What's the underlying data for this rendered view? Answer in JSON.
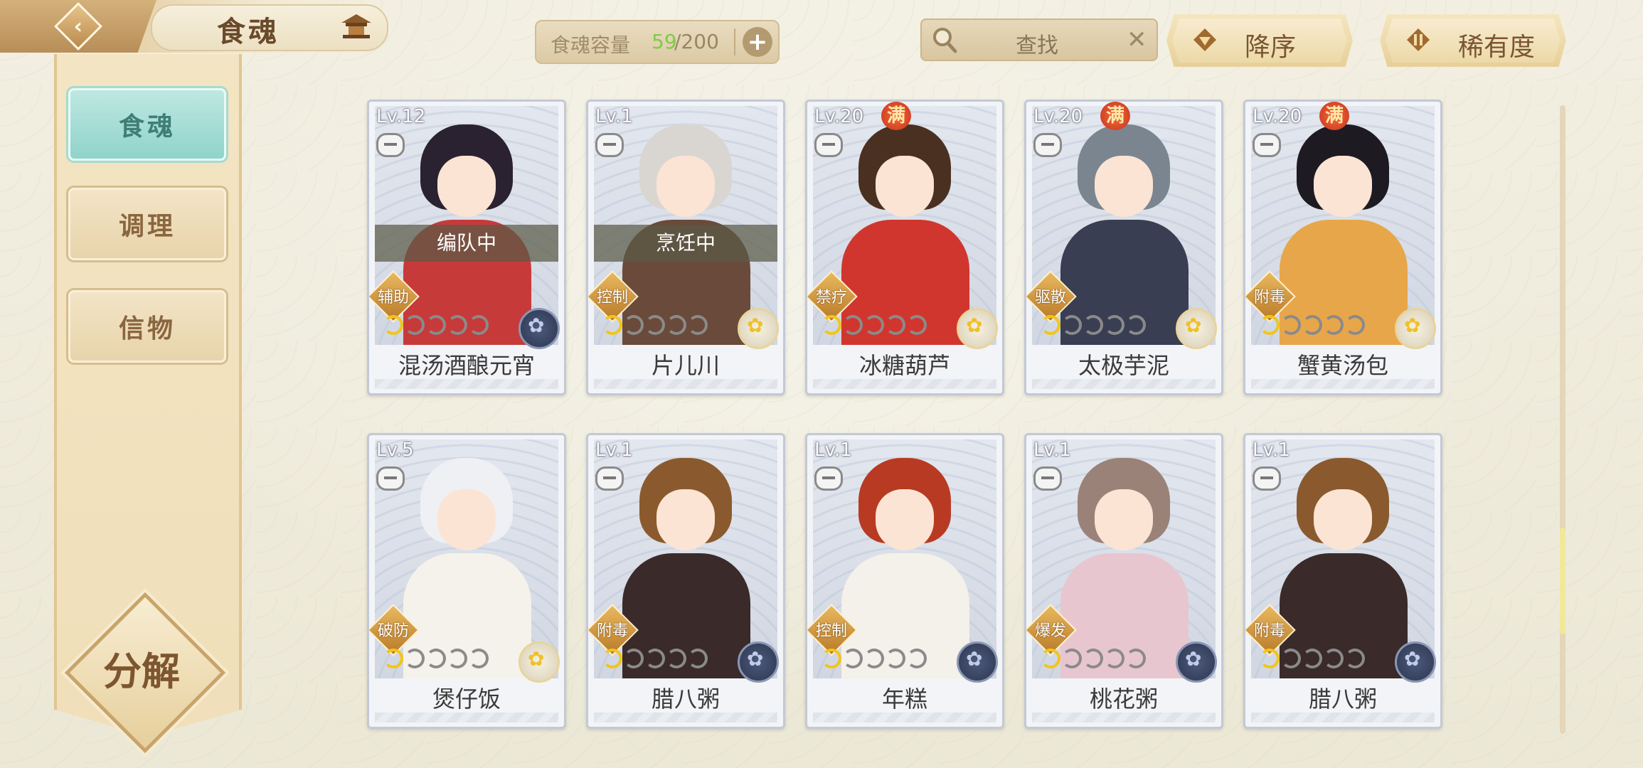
{
  "header": {
    "title": "食魂",
    "capacity_label": "食魂容量",
    "capacity_used": "59",
    "capacity_max": "/200",
    "add_label": "+",
    "search_placeholder": "查找",
    "sort_order_label": "降序",
    "sort_key_label": "稀有度"
  },
  "sidebar": {
    "tabs": [
      {
        "label": "食魂",
        "active": true
      },
      {
        "label": "调理",
        "active": false
      },
      {
        "label": "信物",
        "active": false
      }
    ],
    "decompose_label": "分解"
  },
  "cards": [
    {
      "level": "Lv.12",
      "full": "",
      "status": "编队中",
      "role": "辅助",
      "stars": 1,
      "quality": "dark",
      "name": "混汤酒酿元宵",
      "hair": "#2a2230",
      "body": "#c73a3a"
    },
    {
      "level": "Lv.1",
      "full": "",
      "status": "烹饪中",
      "role": "控制",
      "stars": 1,
      "quality": "gold",
      "name": "片儿川",
      "hair": "#d9d6d2",
      "body": "#6a4a3a"
    },
    {
      "level": "Lv.20",
      "full": "满",
      "status": "",
      "role": "禁疗",
      "stars": 1,
      "quality": "gold",
      "name": "冰糖葫芦",
      "hair": "#4a3020",
      "body": "#d0362e"
    },
    {
      "level": "Lv.20",
      "full": "满",
      "status": "",
      "role": "驱散",
      "stars": 1,
      "quality": "gold",
      "name": "太极芋泥",
      "hair": "#7a8590",
      "body": "#3a3e52"
    },
    {
      "level": "Lv.20",
      "full": "满",
      "status": "",
      "role": "附毒",
      "stars": 1,
      "quality": "gold",
      "name": "蟹黄汤包",
      "hair": "#1e1a22",
      "body": "#e8a64a"
    },
    {
      "level": "Lv.5",
      "full": "",
      "status": "",
      "role": "破防",
      "stars": 1,
      "quality": "gold",
      "name": "煲仔饭",
      "hair": "#eef0f4",
      "body": "#f4f2ea"
    },
    {
      "level": "Lv.1",
      "full": "",
      "status": "",
      "role": "附毒",
      "stars": 1,
      "quality": "dark",
      "name": "腊八粥",
      "hair": "#8a5a2e",
      "body": "#3a2a2a"
    },
    {
      "level": "Lv.1",
      "full": "",
      "status": "",
      "role": "控制",
      "stars": 1,
      "quality": "dark",
      "name": "年糕",
      "hair": "#b83a22",
      "body": "#f4f0ea"
    },
    {
      "level": "Lv.1",
      "full": "",
      "status": "",
      "role": "爆发",
      "stars": 1,
      "quality": "dark",
      "name": "桃花粥",
      "hair": "#9a8278",
      "body": "#e8c6d0"
    },
    {
      "level": "Lv.1",
      "full": "",
      "status": "",
      "role": "附毒",
      "stars": 1,
      "quality": "dark",
      "name": "腊八粥",
      "hair": "#8a5a2e",
      "body": "#3a2a2a"
    }
  ],
  "colors": {
    "accent_teal": "#8fd3ca",
    "capacity_green": "#7fcb4a",
    "full_badge": "#c8331d",
    "star_on": "#f2c518"
  }
}
